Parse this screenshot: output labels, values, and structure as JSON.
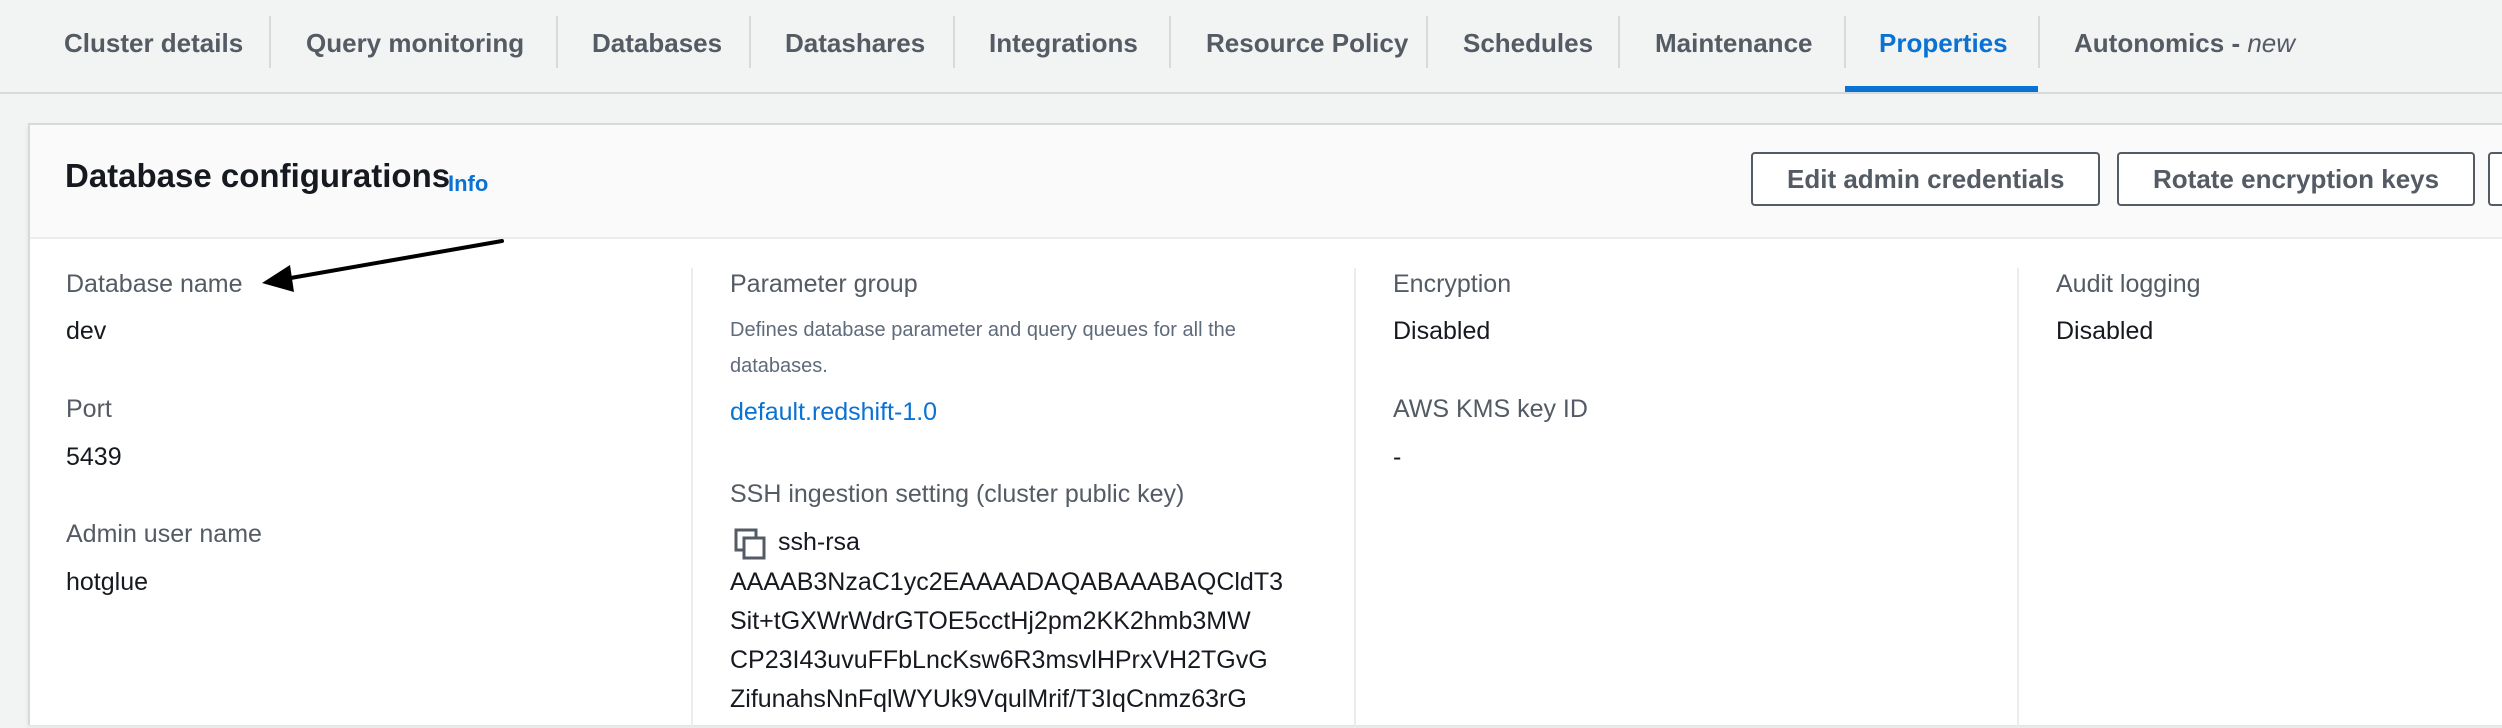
{
  "tabs": [
    {
      "label": "Cluster details"
    },
    {
      "label": "Query monitoring"
    },
    {
      "label": "Databases"
    },
    {
      "label": "Datashares"
    },
    {
      "label": "Integrations"
    },
    {
      "label": "Resource Policy"
    },
    {
      "label": "Schedules"
    },
    {
      "label": "Maintenance"
    },
    {
      "label": "Properties",
      "active": true
    },
    {
      "label": "Autonomics - ",
      "suffix": "new"
    }
  ],
  "panel": {
    "title": "Database configurations",
    "info_label": "Info",
    "buttons": {
      "edit_admin": "Edit admin credentials",
      "rotate_keys": "Rotate encryption keys"
    }
  },
  "col1": {
    "db_name_label": "Database name",
    "db_name_value": "dev",
    "port_label": "Port",
    "port_value": "5439",
    "admin_label": "Admin user name",
    "admin_value": "hotglue"
  },
  "col2": {
    "param_group_label": "Parameter group",
    "param_group_desc": "Defines database parameter and query queues for all the databases.",
    "param_group_value": "default.redshift-1.0",
    "ssh_label": "SSH ingestion setting (cluster public key)",
    "ssh_key_lines": [
      "ssh-rsa",
      "AAAAB3NzaC1yc2EAAAADAQABAAABAQCldT3",
      "Sit+tGXWrWdrGTOE5cctHj2pm2KK2hmb3MW",
      "CP23I43uvuFFbLncKsw6R3msvlHPrxVH2TGvG",
      "ZifunahsNnFqlWYUk9VqulMrif/T3IqCnmz63rG"
    ]
  },
  "col3": {
    "encryption_label": "Encryption",
    "encryption_value": "Disabled",
    "kms_label": "AWS KMS key ID",
    "kms_value": "-"
  },
  "col4": {
    "audit_label": "Audit logging",
    "audit_value": "Disabled"
  },
  "colors": {
    "accent": "#0972d3",
    "label": "#545b64",
    "text": "#16191f"
  }
}
